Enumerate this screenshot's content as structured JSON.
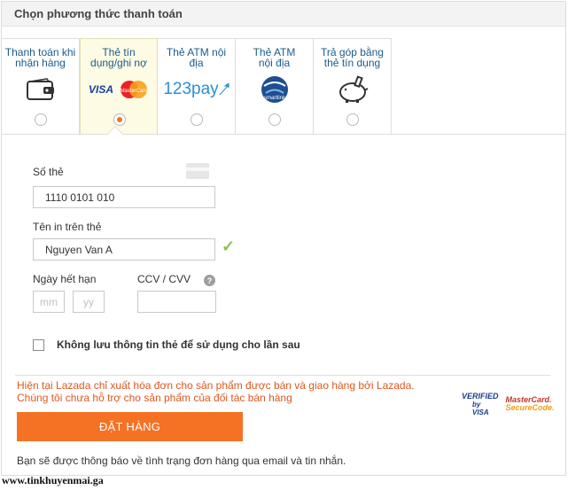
{
  "header": {
    "title": "Chọn phương thức thanh toán"
  },
  "methods": [
    {
      "label_line1": "Thanh toán khi",
      "label_line2": "nhận hàng",
      "icon": "wallet-icon",
      "selected": false
    },
    {
      "label_line1": "Thẻ tín",
      "label_line2": "dụng/ghi nợ",
      "icon": "visa-mastercard-icon",
      "selected": true,
      "logo_visa": "VISA",
      "logo_mc": "MasterCard"
    },
    {
      "label_line1": "Thẻ ATM nội",
      "label_line2": "địa",
      "icon": "123pay-icon",
      "selected": false,
      "logo": "123pay"
    },
    {
      "label_line1": "Thẻ ATM",
      "label_line2": "nội địa",
      "icon": "smartlink-icon",
      "selected": false,
      "logo": "smartlink"
    },
    {
      "label_line1": "Trả góp bằng",
      "label_line2": "thẻ tín dụng",
      "icon": "piggy-bank-icon",
      "selected": false
    }
  ],
  "form": {
    "card_number_label": "Số thẻ",
    "card_number_value": "1110 0101 010",
    "name_label": "Tên in trên thẻ",
    "name_value": "Nguyen Van A",
    "expiry_label": "Ngày hết hạn",
    "expiry_month_placeholder": "mm",
    "expiry_year_placeholder": "yy",
    "cvv_label": "CCV / CVV",
    "cvv_help": "?",
    "save_card_label": "Không lưu thông tin thẻ để sử dụng cho lần sau"
  },
  "notice": {
    "line1": "Hiện tại Lazada chỉ xuất hóa đơn cho sản phẩm được bán và giao hàng bởi Lazada.",
    "line2": "Chúng tôi chưa hỗ trợ cho sản phẩm của đối tác bán hàng"
  },
  "badges": {
    "verified_line1": "VERIFIED",
    "verified_line2": "by VISA",
    "mc_line1": "MasterCard.",
    "mc_line2": "SecureCode."
  },
  "order_button": "ĐẶT HÀNG",
  "info_text": "Bạn sẽ được thông báo về tình trạng đơn hàng qua email và tin nhắn.",
  "watermark": "www.tinkhuyenmai.ga",
  "colors": {
    "accent": "#f57224",
    "link": "#1a5b8f",
    "notice": "#e0571f",
    "check": "#8cc04b"
  }
}
